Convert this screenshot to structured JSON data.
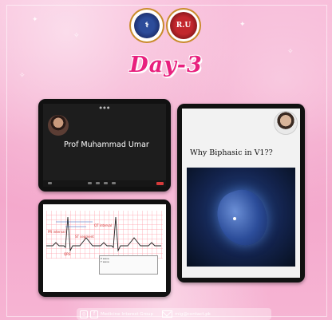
{
  "header": {
    "title": "Day-3",
    "logo_left": {
      "icon": "caduceus-seal-icon",
      "color": "#2c4c9a"
    },
    "logo_right": {
      "icon": "ri-seal-icon",
      "text": "R.U",
      "color": "#c2272d"
    }
  },
  "zoom_call": {
    "speaker_name": "Prof Muhammad Umar"
  },
  "lecture_slide": {
    "title": "Why Biphasic in V1??"
  },
  "ecg_slide": {
    "labels": [
      "PR interval",
      "QRS",
      "ST segment",
      "QT interval",
      "P wave",
      "T wave"
    ]
  },
  "footer": {
    "org": "Medicine Interest Group",
    "email": "mig@contact.pk"
  },
  "colors": {
    "background": "#f4a6cc",
    "title": "#e8207e",
    "accent_gold": "#c98b2b"
  }
}
